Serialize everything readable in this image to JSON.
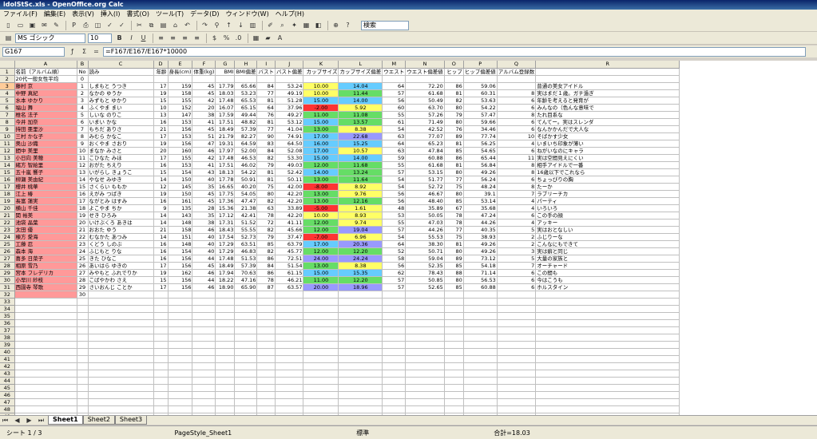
{
  "window": {
    "title": "idolStSc.xls - OpenOffice.org Calc"
  },
  "menu": [
    "ファイル(F)",
    "編集(E)",
    "表示(V)",
    "挿入(I)",
    "書式(O)",
    "ツール(T)",
    "データ(D)",
    "ウィンドウ(W)",
    "ヘルプ(H)"
  ],
  "toolbar": {
    "font_name": "MS ゴシック",
    "font_size": "10",
    "search_placeholder": "検索",
    "icons": [
      "new-icon",
      "open-icon",
      "save-icon",
      "email-icon",
      "edit-icon",
      "pdf-icon",
      "print-icon",
      "preview-icon",
      "spellcheck-icon",
      "autospell-icon",
      "cut-icon",
      "copy-icon",
      "paste-icon",
      "format-paint-icon",
      "undo-icon",
      "redo-icon",
      "hyperlink-icon",
      "sort-asc-icon",
      "sort-desc-icon",
      "chart-icon",
      "draw-icon",
      "find-icon",
      "navigator-icon",
      "gallery-icon",
      "datasource-icon",
      "zoom-icon",
      "help-icon"
    ]
  },
  "formula_bar": {
    "name_box": "G167",
    "formula": "=F167/E167/E167*10000"
  },
  "columns": [
    "A",
    "B",
    "C",
    "D",
    "E",
    "F",
    "G",
    "H",
    "I",
    "J",
    "K",
    "L",
    "M",
    "N",
    "O",
    "P",
    "Q",
    "R",
    "S",
    "T"
  ],
  "table": {
    "header_row": [
      "名前（アルバム順）",
      "No",
      "読み",
      "年齢",
      "身長(cm)",
      "体重(kg)",
      "BMI",
      "BMI偏差",
      "バスト",
      "バスト偏差",
      "カップサイズ",
      "カップサイズ偏差",
      "ウエスト",
      "ウエスト偏差値",
      "ヒップ",
      "ヒップ偏差値",
      "アルバム登録数",
      ""
    ],
    "avg_row": [
      "20代一般女性平均",
      "0",
      "",
      "",
      "",
      "",
      "",
      "",
      "",
      "",
      "",
      "",
      "",
      "",
      "",
      "",
      "",
      ""
    ],
    "rows": [
      [
        "藤村 京",
        "1",
        "しまもと うつき",
        "17",
        "159",
        "45",
        "17.79",
        "65.66",
        "84",
        "53.24",
        "10.00",
        "14.04",
        "64",
        "72.20",
        "86",
        "59.06",
        "",
        "普通の美女アイドル"
      ],
      [
        "中野 真紀",
        "2",
        "なかの ゆうか",
        "19",
        "158",
        "45",
        "18.03",
        "53.23",
        "77",
        "49.19",
        "10.00",
        "11.44",
        "57",
        "61.68",
        "81",
        "60.31",
        "8",
        "実はまだ１歳。ガチ過ぎ"
      ],
      [
        "水本 ゆかり",
        "3",
        "みずもと ゆかり",
        "15",
        "155",
        "42",
        "17.48",
        "65.53",
        "81",
        "51.28",
        "15.00",
        "14.00",
        "56",
        "50.49",
        "82",
        "53.63",
        "6",
        "年齢を考えると発育が"
      ],
      [
        "福山 舞",
        "4",
        "ふくやま まい",
        "10",
        "152",
        "20",
        "16.07",
        "65.15",
        "64",
        "37.96",
        "-2.00",
        "5.92",
        "60",
        "63.70",
        "80",
        "54.22",
        "6",
        "みんなの（色んな意味で"
      ],
      [
        "椎名 法子",
        "5",
        "しいな のりこ",
        "13",
        "147",
        "38",
        "17.59",
        "49.44",
        "76",
        "49.27",
        "11.00",
        "11.08",
        "55",
        "57.26",
        "79",
        "57.47",
        "8",
        "たれ目系な"
      ],
      [
        "今井 加奈",
        "6",
        "いまい かな",
        "16",
        "153",
        "41",
        "17.51",
        "48.82",
        "81",
        "53.12",
        "15.00",
        "13.57",
        "61",
        "71.49",
        "80",
        "59.66",
        "6",
        "てんてー。実はスレンダ"
      ],
      [
        "持田 亜里沙",
        "7",
        "もちだ ありさ",
        "21",
        "156",
        "45",
        "18.49",
        "57.39",
        "77",
        "41.04",
        "13.00",
        "8.38",
        "54",
        "42.52",
        "76",
        "34.46",
        "6",
        "なんかかんだで大人な"
      ],
      [
        "三村 かな子",
        "8",
        "みむら かなこ",
        "17",
        "153",
        "51",
        "21.79",
        "82.27",
        "90",
        "74.91",
        "17.00",
        "22.68",
        "63",
        "77.07",
        "89",
        "77.74",
        "10",
        "そばかす少女"
      ],
      [
        "奥山 沙織",
        "9",
        "おくやま さおり",
        "19",
        "156",
        "47",
        "19.31",
        "64.59",
        "83",
        "64.50",
        "16.00",
        "15.25",
        "64",
        "65.23",
        "81",
        "56.25",
        "4",
        "いまいち印象が薄い"
      ],
      [
        "間中 美里",
        "10",
        "まなか みさと",
        "20",
        "160",
        "46",
        "17.97",
        "52.00",
        "84",
        "52.08",
        "17.00",
        "10.57",
        "63",
        "47.84",
        "85",
        "54.65",
        "6",
        "ねがいなのにキャラ"
      ],
      [
        "小日向 美穂",
        "11",
        "こひなた みほ",
        "17",
        "155",
        "42",
        "17.48",
        "46.53",
        "82",
        "53.30",
        "15.00",
        "14.00",
        "59",
        "60.88",
        "86",
        "65.44",
        "11",
        "実は空間見えにくい"
      ],
      [
        "緒方 智絵里",
        "12",
        "おがた ちえり",
        "16",
        "153",
        "41",
        "17.51",
        "46.02",
        "79",
        "49.03",
        "12.00",
        "11.68",
        "55",
        "61.68",
        "81",
        "56.84",
        "8",
        "相手アイドルで一番"
      ],
      [
        "五十嵐 響子",
        "13",
        "いがらし きょうこ",
        "15",
        "154",
        "43",
        "18.13",
        "54.22",
        "81",
        "52.42",
        "14.00",
        "13.24",
        "57",
        "53.15",
        "80",
        "49.26",
        "8",
        "16歳以下でこれなら"
      ],
      [
        "柳瀬 美由紀",
        "14",
        "やなせ みゆき",
        "14",
        "150",
        "40",
        "17.78",
        "50.91",
        "81",
        "50.11",
        "13.00",
        "11.64",
        "54",
        "51.77",
        "77",
        "56.24",
        "6",
        "ちょっぴりの胸"
      ],
      [
        "櫻井 桃華",
        "15",
        "さくらい ももか",
        "12",
        "145",
        "35",
        "16.65",
        "40.20",
        "75",
        "42.00",
        "-8.00",
        "8.92",
        "54",
        "52.72",
        "75",
        "48.24",
        "8",
        "たーか"
      ],
      [
        "江上 椿",
        "16",
        "えがみ つばき",
        "19",
        "150",
        "45",
        "17.75",
        "54.05",
        "80",
        "42.20",
        "13.00",
        "9.76",
        "56",
        "46.67",
        "80",
        "39.1",
        "7",
        "ラブリーチカ"
      ],
      [
        "長富 蓮実",
        "17",
        "ながとみ はすみ",
        "16",
        "161",
        "45",
        "17.36",
        "47.47",
        "82",
        "42.20",
        "13.00",
        "12.16",
        "56",
        "48.40",
        "85",
        "53.14",
        "4",
        "パーティ"
      ],
      [
        "横山 千佳",
        "18",
        "よこやま ちか",
        "9",
        "135",
        "28",
        "15.36",
        "21.38",
        "63",
        "33.89",
        "-5.00",
        "1.61",
        "48",
        "35.89",
        "67",
        "35.68",
        "4",
        "いろいろ"
      ],
      [
        "関 裕美",
        "19",
        "せき ひろみ",
        "14",
        "143",
        "35",
        "17.12",
        "42.41",
        "78",
        "42.20",
        "10.00",
        "8.93",
        "53",
        "50.05",
        "78",
        "47.24",
        "6",
        "この手の顔"
      ],
      [
        "池袋 晶葉",
        "20",
        "いけぶくろ あきは",
        "14",
        "148",
        "38",
        "17.31",
        "51.52",
        "72",
        "41.11",
        "12.00",
        "9.74",
        "55",
        "47.03",
        "78",
        "44.26",
        "4",
        "アッキー"
      ],
      [
        "太田 優",
        "21",
        "おおた ゆう",
        "21",
        "158",
        "46",
        "18.43",
        "55.55",
        "82",
        "45.66",
        "12.00",
        "19.04",
        "57",
        "44.26",
        "77",
        "40.35",
        "5",
        "実はおとなしい"
      ],
      [
        "棟方 愛海",
        "22",
        "むなかた あつみ",
        "14",
        "151",
        "40",
        "17.54",
        "52.73",
        "79",
        "37.47",
        "-7.00",
        "6.96",
        "54",
        "55.53",
        "75",
        "38.93",
        "2",
        "ふじりーな"
      ],
      [
        "工藤 忍",
        "23",
        "くどう しのぶ",
        "16",
        "148",
        "40",
        "17.29",
        "63.51",
        "85",
        "63.79",
        "17.00",
        "20.36",
        "64",
        "38.30",
        "81",
        "49.26",
        "2",
        "こんなにもできて"
      ],
      [
        "森本 海",
        "24",
        "ふじもと りな",
        "16",
        "154",
        "40",
        "17.29",
        "46.83",
        "82",
        "45.77",
        "12.00",
        "12.20",
        "52",
        "50.71",
        "80",
        "49.26",
        "3",
        "実は癖と同じ"
      ],
      [
        "喜多 日菜子",
        "25",
        "きた ひなこ",
        "16",
        "156",
        "44",
        "17.48",
        "51.53",
        "86",
        "72.51",
        "24.00",
        "24.24",
        "58",
        "59.04",
        "89",
        "73.12",
        "5",
        "大量の家族と"
      ],
      [
        "相原 雪乃",
        "26",
        "あいはら ゆきの",
        "17",
        "156",
        "45",
        "18.49",
        "57.39",
        "84",
        "51.54",
        "13.00",
        "8.38",
        "56",
        "52.35",
        "85",
        "54.18",
        "7",
        "オーチャード"
      ],
      [
        "宮本 フレデリカ",
        "27",
        "みやもと ふれでりか",
        "19",
        "162",
        "46",
        "17.94",
        "70.63",
        "86",
        "61.15",
        "15.00",
        "15.35",
        "62",
        "78.43",
        "88",
        "71.14",
        "6",
        "この間も"
      ],
      [
        "小早川 紗枝",
        "28",
        "こばやかわ さえ",
        "15",
        "156",
        "44",
        "18.22",
        "47.16",
        "78",
        "46.21",
        "11.00",
        "12.20",
        "57",
        "50.85",
        "80",
        "56.53",
        "6",
        "今はこうも"
      ],
      [
        "西園寺 琴歌",
        "29",
        "さいおんじ ことか",
        "17",
        "156",
        "46",
        "18.90",
        "65.90",
        "87",
        "63.57",
        "20.00",
        "18.96",
        "57",
        "52.65",
        "85",
        "60.88",
        "6",
        "ホルスタイン"
      ],
      [
        "",
        "30",
        "",
        "",
        "",
        "",
        "",
        "",
        "",
        "",
        "",
        "",
        "",
        "",
        "",
        "",
        "",
        ""
      ]
    ],
    "total_rows": 52
  },
  "sheets": [
    "Sheet1",
    "Sheet2",
    "Sheet3"
  ],
  "status": {
    "sheet": "シート 1 / 3",
    "page_style": "PageStyle_Sheet1",
    "mode": "標準",
    "sum": "合計=18.03"
  },
  "colors": {
    "accent": "#ff9999",
    "yellow": "#ffff66",
    "green": "#66dd66",
    "blue": "#66ccff",
    "red": "#ff3333",
    "purple": "#9999ff"
  }
}
